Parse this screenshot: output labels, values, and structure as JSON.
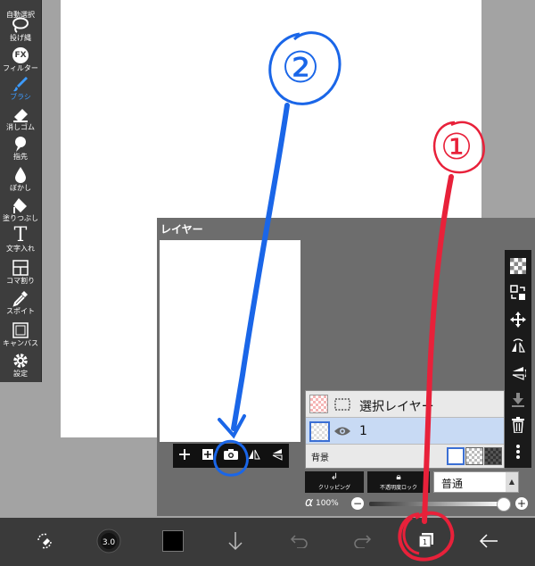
{
  "tools": [
    {
      "name": "auto-select",
      "label": "自動選択",
      "icon": "magic-wand-icon"
    },
    {
      "name": "lasso",
      "label": "投げ縄",
      "icon": "lasso-icon"
    },
    {
      "name": "filter",
      "label": "フィルター",
      "icon": "fx-icon",
      "icon_text": "FX"
    },
    {
      "name": "brush",
      "label": "ブラシ",
      "icon": "brush-icon",
      "active": true
    },
    {
      "name": "eraser",
      "label": "消しゴム",
      "icon": "eraser-icon"
    },
    {
      "name": "finger",
      "label": "指先",
      "icon": "finger-icon"
    },
    {
      "name": "blur",
      "label": "ぼかし",
      "icon": "drop-icon"
    },
    {
      "name": "fill",
      "label": "塗りつぶし",
      "icon": "bucket-icon"
    },
    {
      "name": "text",
      "label": "文字入れ",
      "icon": "text-icon",
      "icon_text": "T"
    },
    {
      "name": "frame",
      "label": "コマ割り",
      "icon": "frame-icon"
    },
    {
      "name": "eyedropper",
      "label": "スポイト",
      "icon": "eyedropper-icon"
    },
    {
      "name": "canvas",
      "label": "キャンバス",
      "icon": "canvas-icon"
    },
    {
      "name": "settings",
      "label": "設定",
      "icon": "gear-icon"
    }
  ],
  "layer_panel": {
    "title": "レイヤー",
    "layers": [
      {
        "name": "選択レイヤー",
        "selected": false
      },
      {
        "name": "1",
        "selected": true
      }
    ],
    "background_label": "背景",
    "clipping_label": "クリッピング",
    "opacity_lock_label": "不透明度ロック",
    "blend_mode": "普通",
    "opacity_symbol": "α",
    "opacity": "100%",
    "opacity_value": 100
  },
  "annotations": {
    "first": "①",
    "second": "②"
  },
  "colors": {
    "accent": "#3d9bff",
    "annotation_red": "#e8213a",
    "annotation_blue": "#1a66e8",
    "panel": "#6d6d6d",
    "toolbar": "#3d3d3d"
  }
}
